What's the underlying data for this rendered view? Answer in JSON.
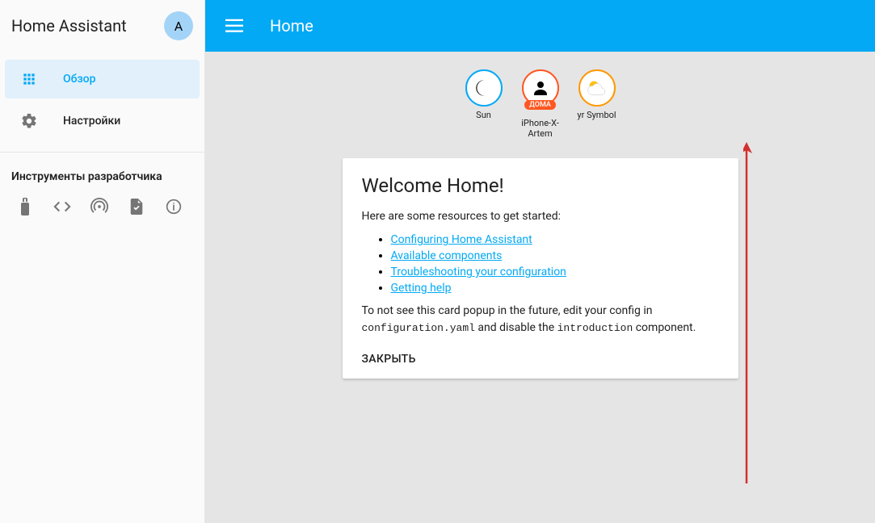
{
  "sidebar": {
    "title": "Home Assistant",
    "avatar_initial": "A",
    "nav": [
      {
        "label": "Обзор",
        "icon": "apps-icon"
      },
      {
        "label": "Настройки",
        "icon": "gear-icon"
      }
    ],
    "dev_tools_title": "Инструменты разработчика"
  },
  "toolbar": {
    "title": "Home"
  },
  "badges": [
    {
      "label": "Sun",
      "type": "sun"
    },
    {
      "label": "iPhone-X-Artem",
      "type": "person",
      "status": "ДОМА"
    },
    {
      "label": "yr Symbol",
      "type": "weather"
    }
  ],
  "card": {
    "title": "Welcome Home!",
    "intro": "Here are some resources to get started:",
    "links": [
      "Configuring Home Assistant",
      "Available components",
      "Troubleshooting your configuration",
      "Getting help"
    ],
    "outro_pre": "To not see this card popup in the future, edit your config in ",
    "outro_code1": "configuration.yaml",
    "outro_mid": " and disable the ",
    "outro_code2": "introduction",
    "outro_post": " component.",
    "close_label": "ЗАКРЫТЬ"
  }
}
